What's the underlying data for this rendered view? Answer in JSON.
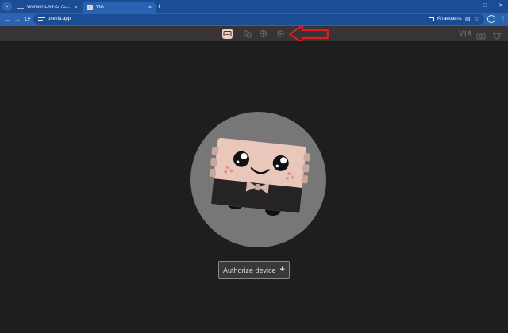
{
  "browser": {
    "tabs": [
      {
        "title": "Womier EK475 75% Wireless A",
        "close": "×"
      },
      {
        "title": "VIA",
        "close": "×"
      }
    ],
    "new_tab": "+",
    "window_controls": {
      "minimize": "–",
      "maximize": "□",
      "close": "✕"
    },
    "nav": {
      "back": "←",
      "forward": "→",
      "reload": "⟳"
    },
    "url": "usevia.app",
    "install_label": "Установить",
    "icons": {
      "translate": "translate-icon",
      "bookmark": "☆",
      "menu": "⋮"
    }
  },
  "app": {
    "logo": "VIA",
    "header_icons": [
      "keyboard-icon",
      "lighting-icon",
      "macro-icon",
      "settings-icon"
    ],
    "right_icons": [
      "design-icon",
      "bug-icon"
    ],
    "highlight_arrow_color": "#e01b24"
  },
  "main": {
    "authorize_label": "Authorize device",
    "authorize_plus": "+"
  },
  "colors": {
    "tabstrip": "#1b4d95",
    "toolbar": "#2b63b3",
    "appbar": "#363436",
    "background": "#1f1e1f",
    "accent": "#f2cfc5"
  }
}
